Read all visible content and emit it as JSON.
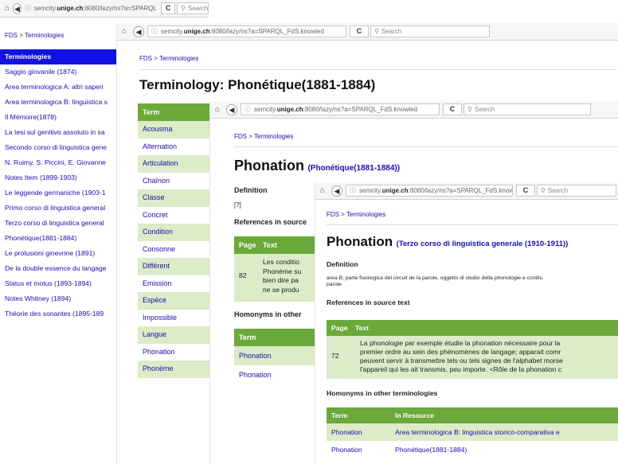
{
  "browser": {
    "url_prefix": "semcity.",
    "url_domain": "unige.ch",
    "url_rest": ":8080/lazy/ns?a=SPARQL_FdS.knowled",
    "url_rest_w1": ":8080/lazy/ns?a=SPARQL_FdS.knowled",
    "search_placeholder": "Search",
    "reload": "C"
  },
  "breadcrumb": {
    "root": "FDS",
    "sep": ">",
    "current": "Terminologies"
  },
  "sidebar": {
    "header": "Terminologies",
    "items": [
      "Saggio giovanile (1874)",
      "Area terminologica A: altri saperi",
      "Area terminologica B: linguistica s",
      "Il Mémoire(1878)",
      "La tesi sul genitivo assoluto in sa",
      "Secondo corso di linguistica gene",
      "N. Ruimy, S. Piccini, E. Giovanne",
      "Notes Item (1899-1903)",
      "Le leggende germaniche (1903-1",
      "Primo corso di linguistica general",
      "Terzo corso di linguistica general",
      "Phonétique(1881-1884)",
      "Le prolusioni ginevrine (1891)",
      "De la double essence du langage",
      "Status et motus (1893-1894)",
      "Notes Whitney (1894)",
      "Théorie des sonantes (1895-189"
    ]
  },
  "window2": {
    "title": "Terminology: Phonétique(1881-1884)",
    "term_header": "Term",
    "terms": [
      "Acousma",
      "Alternation",
      "Articulation",
      "Chaînon",
      "Classe",
      "Concret",
      "Condition",
      "Consonne",
      "Différent",
      "Emission",
      "Espèce",
      "Impossible",
      "Langue",
      "Phonation",
      "Phonème"
    ]
  },
  "window3": {
    "title": "Phonation",
    "resource": "(Phonétique(1881-1884))",
    "definition_heading": "Definition",
    "definition_text": "[?]",
    "references_heading": "References in source",
    "ref_headers": [
      "Page",
      "Text"
    ],
    "ref_page": "82",
    "ref_lines": [
      "Les conditio",
      "Phonème su",
      "bien dire pa",
      "ne se produ"
    ],
    "homonyms_heading": "Homonyms in other",
    "hom_header": "Term",
    "hom_terms": [
      "Phonation",
      "Phonation"
    ]
  },
  "window4": {
    "title": "Phonation",
    "resource": "(Terzo corso di linguistica generale (1910-1911))",
    "definition_heading": "Definition",
    "definition_lines": [
      "area B; parte fisiologica del circuit de la parole, oggetto di studio della phonologie e costitu",
      "parole"
    ],
    "references_heading": "References in source text",
    "ref_headers": [
      "Page",
      "Text"
    ],
    "ref_page": "72",
    "ref_lines": [
      "La phonologie par exemple étudie la phonation nécessaire pour la",
      "premier ordre au sein des phénomènes de langage; apparait comr",
      "peuvent servir à transmettre tels ou tels signes de l'alphabet morse",
      "l'appareil qui les ait transmis, peu importe. <Rôle de la phonation c"
    ],
    "homonyms_heading": "Homonyms in other terminologies",
    "hom_headers": [
      "Term",
      "In Resource"
    ],
    "hom_rows": [
      {
        "term": "Phonation",
        "resource": "Area terminologica B: linguistica storico-comparativa e"
      },
      {
        "term": "Phonation",
        "resource": "Phonétique(1881-1884)"
      }
    ]
  }
}
